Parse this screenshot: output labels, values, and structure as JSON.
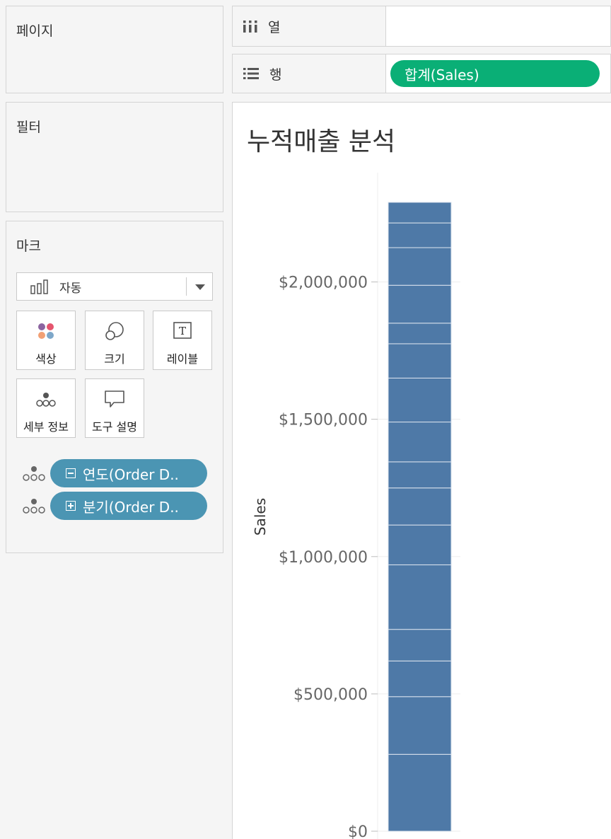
{
  "left": {
    "pages_title": "페이지",
    "filters_title": "필터",
    "marks": {
      "title": "마크",
      "mark_type": "자동",
      "buttons": [
        {
          "label": "색상",
          "icon": "color-icon"
        },
        {
          "label": "크기",
          "icon": "size-icon"
        },
        {
          "label": "레이블",
          "icon": "label-icon"
        },
        {
          "label": "세부 정보",
          "icon": "detail-icon"
        },
        {
          "label": "도구 설명",
          "icon": "tooltip-icon"
        }
      ],
      "fields": [
        {
          "label": "연도(Order D..",
          "expand": "minus"
        },
        {
          "label": "분기(Order D..",
          "expand": "plus"
        }
      ]
    }
  },
  "shelves": {
    "columns_label": "열",
    "rows_label": "행",
    "rows_pill": "합계(Sales)"
  },
  "viz": {
    "title": "누적매출 분석"
  },
  "colors": {
    "bar": "#4e79a7",
    "rows_pill": "#0aaf76",
    "field_pill": "#4b95b3"
  },
  "chart_data": {
    "type": "bar",
    "stacked": true,
    "categories": [
      ""
    ],
    "segments_top_values": [
      0,
      280000,
      490000,
      620000,
      735000,
      970000,
      1115000,
      1250000,
      1345000,
      1490000,
      1650000,
      1775000,
      1850000,
      1988000,
      2125000,
      2215000
    ],
    "total": 2290000,
    "ylabel": "Sales",
    "ylim": [
      0,
      2290000
    ],
    "yticks": [
      {
        "value": 0,
        "label": "$0"
      },
      {
        "value": 500000,
        "label": "$500,000"
      },
      {
        "value": 1000000,
        "label": "$1,000,000"
      },
      {
        "value": 1500000,
        "label": "$1,500,000"
      },
      {
        "value": 2000000,
        "label": "$2,000,000"
      }
    ],
    "grid": true
  }
}
